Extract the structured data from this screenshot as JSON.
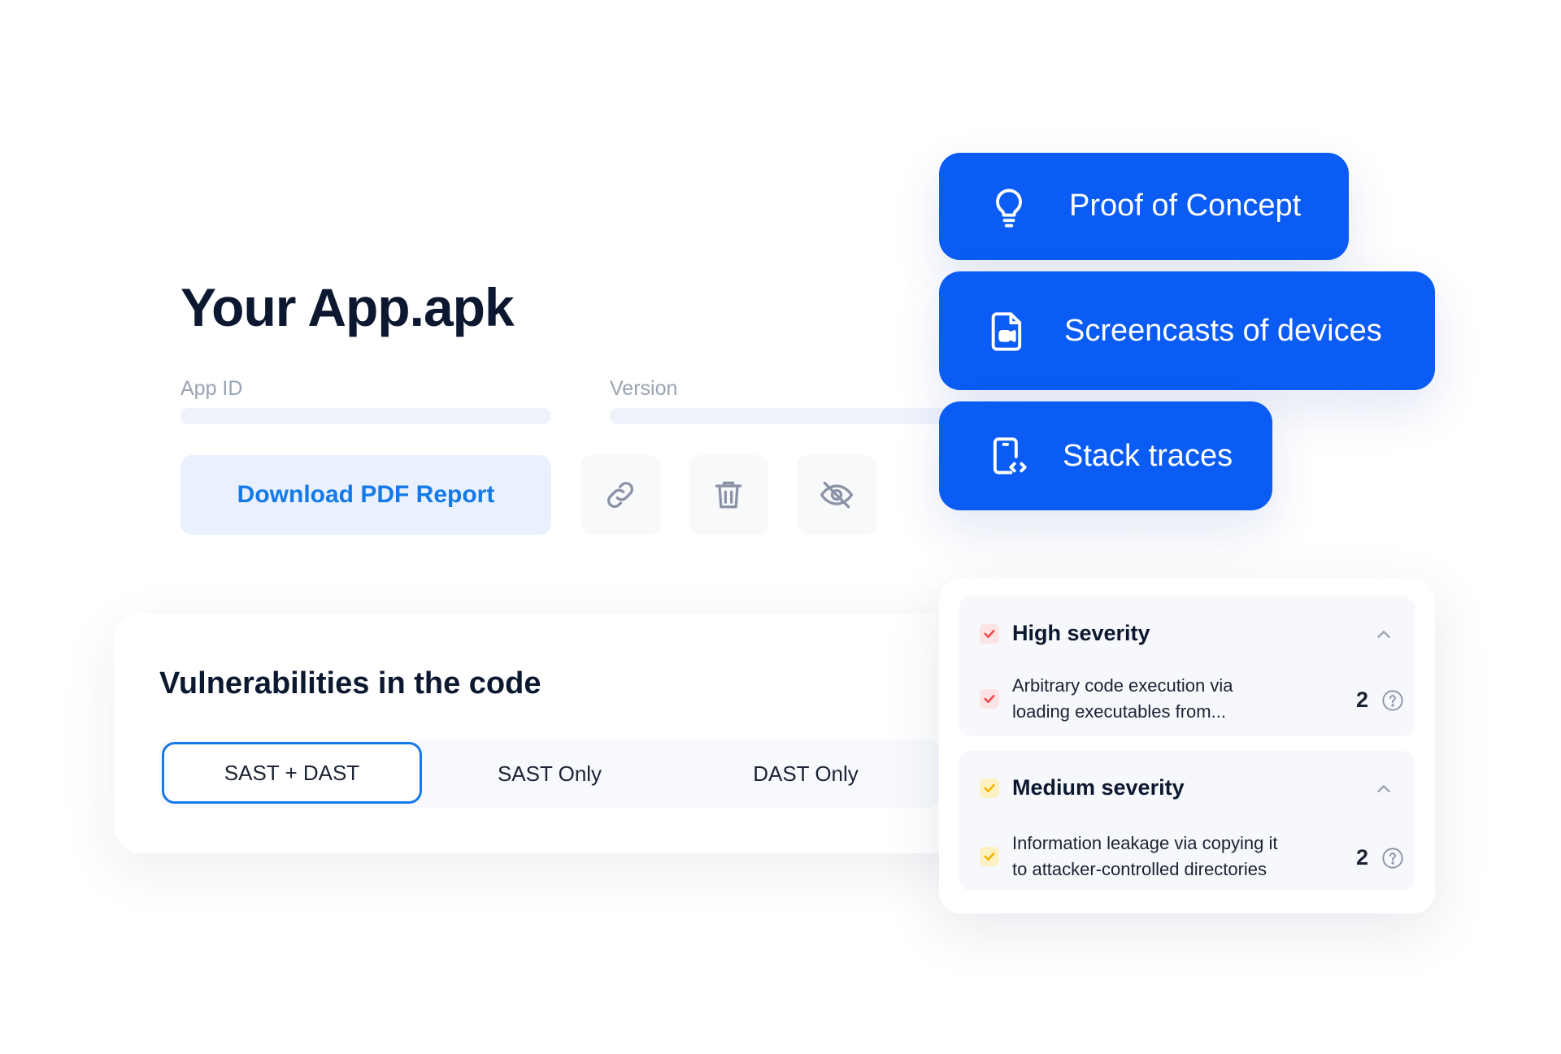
{
  "app": {
    "title": "Your App.apk",
    "app_id_label": "App ID",
    "version_label": "Version",
    "download_label": "Download PDF Report",
    "actions": [
      "link-icon",
      "trash-icon",
      "eye-off-icon"
    ]
  },
  "features": [
    {
      "label": "Proof of Concept",
      "icon": "lightbulb-icon"
    },
    {
      "label": "Screencasts of devices",
      "icon": "video-file-icon"
    },
    {
      "label": "Stack traces",
      "icon": "phone-code-icon"
    }
  ],
  "vulnerabilities": {
    "title": "Vulnerabilities in the code",
    "tabs": [
      "SAST + DAST",
      "SAST Only",
      "DAST Only"
    ],
    "active_tab": "SAST + DAST"
  },
  "severity": {
    "high": {
      "label": "High severity",
      "item_line1": "Arbitrary code execution via",
      "item_line2": "loading executables from...",
      "count": "2"
    },
    "medium": {
      "label": "Medium severity",
      "item_line1": "Information leakage via copying it",
      "item_line2": "to attacker-controlled directories",
      "count": "2"
    }
  },
  "colors": {
    "accent_blue": "#0a5cf5",
    "link_blue": "#1679e8",
    "high_red": "#f04b4b",
    "medium_yellow": "#f5c518"
  }
}
